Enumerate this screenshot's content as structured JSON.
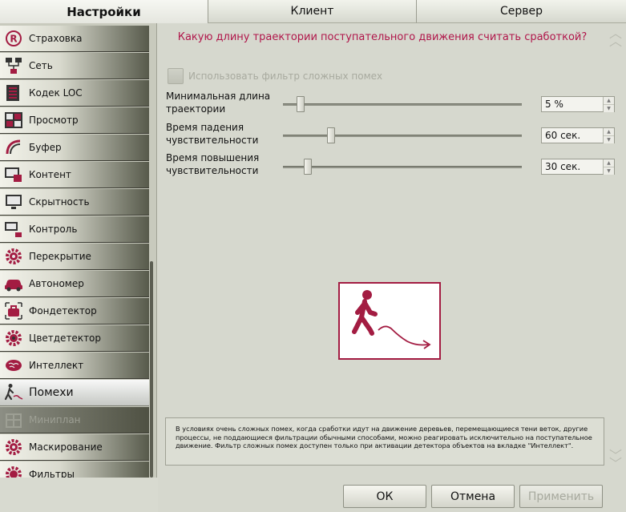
{
  "tabs": [
    {
      "label": "Настройки"
    },
    {
      "label": "Клиент"
    },
    {
      "label": "Сервер"
    }
  ],
  "sidebar": {
    "items": [
      {
        "label": "Страховка"
      },
      {
        "label": "Сеть"
      },
      {
        "label": "Кодек LOC"
      },
      {
        "label": "Просмотр"
      },
      {
        "label": "Буфер"
      },
      {
        "label": "Контент"
      },
      {
        "label": "Скрытность"
      },
      {
        "label": "Контроль"
      },
      {
        "label": "Перекрытие"
      },
      {
        "label": "Автономер"
      },
      {
        "label": "Фондетектор"
      },
      {
        "label": "Цветдетектор"
      },
      {
        "label": "Интеллект"
      },
      {
        "label": "Помехи"
      },
      {
        "label": "Миниплан"
      },
      {
        "label": "Маскирование"
      },
      {
        "label": "Фильтры"
      }
    ]
  },
  "main": {
    "question": "Какую длину траектории поступательного движения считать сработкой?",
    "filter_label": "Использовать фильтр сложных помех",
    "params": [
      {
        "label_line1": "Минимальная длина",
        "label_line2": "траектории",
        "value": "5 %",
        "slider_fraction": 0.06
      },
      {
        "label_line1": "Время падения",
        "label_line2": "чувствительности",
        "value": "60 сек.",
        "slider_fraction": 0.19
      },
      {
        "label_line1": "Время повышения",
        "label_line2": "чувствительности",
        "value": "30 сек.",
        "slider_fraction": 0.09
      }
    ],
    "hint": "В условиях очень сложных помех, когда сработки идут на движение деревьев, перемещающиеся тени веток, другие процессы, не поддающиеся фильтрации обычными способами, можно реагировать исключительно на поступательное движение. Фильтр сложных помех доступен только при активации детектора объектов на вкладке \"Интеллект\"."
  },
  "buttons": {
    "ok": "ОК",
    "cancel": "Отмена",
    "apply": "Применить"
  },
  "colors": {
    "accent": "#b0164a",
    "icon": "#a31c42"
  }
}
